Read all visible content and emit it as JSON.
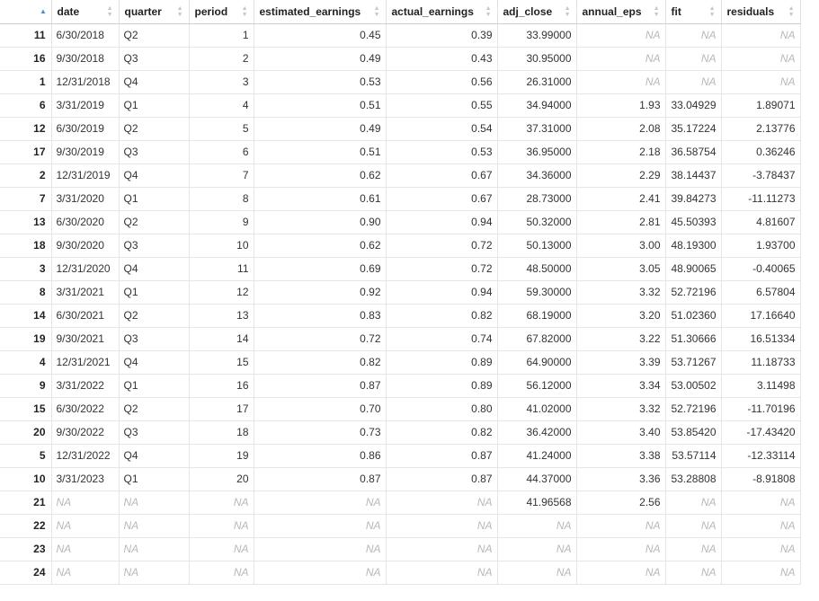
{
  "columns": [
    {
      "key": "idx",
      "label": "",
      "align": "r"
    },
    {
      "key": "date",
      "label": "date",
      "align": "l"
    },
    {
      "key": "quarter",
      "label": "quarter",
      "align": "l"
    },
    {
      "key": "period",
      "label": "period",
      "align": "r"
    },
    {
      "key": "estimated_earnings",
      "label": "estimated_earnings",
      "align": "r"
    },
    {
      "key": "actual_earnings",
      "label": "actual_earnings",
      "align": "r"
    },
    {
      "key": "adj_close",
      "label": "adj_close",
      "align": "r"
    },
    {
      "key": "annual_eps",
      "label": "annual_eps",
      "align": "r"
    },
    {
      "key": "fit",
      "label": "fit",
      "align": "r"
    },
    {
      "key": "residuals",
      "label": "residuals",
      "align": "r"
    }
  ],
  "sort": {
    "column": "idx",
    "direction": "ascending",
    "icon": "sort-ascending-icon"
  },
  "na_text": "NA",
  "rows": [
    [
      "11",
      "6/30/2018",
      "Q2",
      "1",
      "0.45",
      "0.39",
      "33.99000",
      "NA",
      "NA",
      "NA"
    ],
    [
      "16",
      "9/30/2018",
      "Q3",
      "2",
      "0.49",
      "0.43",
      "30.95000",
      "NA",
      "NA",
      "NA"
    ],
    [
      "1",
      "12/31/2018",
      "Q4",
      "3",
      "0.53",
      "0.56",
      "26.31000",
      "NA",
      "NA",
      "NA"
    ],
    [
      "6",
      "3/31/2019",
      "Q1",
      "4",
      "0.51",
      "0.55",
      "34.94000",
      "1.93",
      "33.04929",
      "1.89071"
    ],
    [
      "12",
      "6/30/2019",
      "Q2",
      "5",
      "0.49",
      "0.54",
      "37.31000",
      "2.08",
      "35.17224",
      "2.13776"
    ],
    [
      "17",
      "9/30/2019",
      "Q3",
      "6",
      "0.51",
      "0.53",
      "36.95000",
      "2.18",
      "36.58754",
      "0.36246"
    ],
    [
      "2",
      "12/31/2019",
      "Q4",
      "7",
      "0.62",
      "0.67",
      "34.36000",
      "2.29",
      "38.14437",
      "-3.78437"
    ],
    [
      "7",
      "3/31/2020",
      "Q1",
      "8",
      "0.61",
      "0.67",
      "28.73000",
      "2.41",
      "39.84273",
      "-11.11273"
    ],
    [
      "13",
      "6/30/2020",
      "Q2",
      "9",
      "0.90",
      "0.94",
      "50.32000",
      "2.81",
      "45.50393",
      "4.81607"
    ],
    [
      "18",
      "9/30/2020",
      "Q3",
      "10",
      "0.62",
      "0.72",
      "50.13000",
      "3.00",
      "48.19300",
      "1.93700"
    ],
    [
      "3",
      "12/31/2020",
      "Q4",
      "11",
      "0.69",
      "0.72",
      "48.50000",
      "3.05",
      "48.90065",
      "-0.40065"
    ],
    [
      "8",
      "3/31/2021",
      "Q1",
      "12",
      "0.92",
      "0.94",
      "59.30000",
      "3.32",
      "52.72196",
      "6.57804"
    ],
    [
      "14",
      "6/30/2021",
      "Q2",
      "13",
      "0.83",
      "0.82",
      "68.19000",
      "3.20",
      "51.02360",
      "17.16640"
    ],
    [
      "19",
      "9/30/2021",
      "Q3",
      "14",
      "0.72",
      "0.74",
      "67.82000",
      "3.22",
      "51.30666",
      "16.51334"
    ],
    [
      "4",
      "12/31/2021",
      "Q4",
      "15",
      "0.82",
      "0.89",
      "64.90000",
      "3.39",
      "53.71267",
      "11.18733"
    ],
    [
      "9",
      "3/31/2022",
      "Q1",
      "16",
      "0.87",
      "0.89",
      "56.12000",
      "3.34",
      "53.00502",
      "3.11498"
    ],
    [
      "15",
      "6/30/2022",
      "Q2",
      "17",
      "0.70",
      "0.80",
      "41.02000",
      "3.32",
      "52.72196",
      "-11.70196"
    ],
    [
      "20",
      "9/30/2022",
      "Q3",
      "18",
      "0.73",
      "0.82",
      "36.42000",
      "3.40",
      "53.85420",
      "-17.43420"
    ],
    [
      "5",
      "12/31/2022",
      "Q4",
      "19",
      "0.86",
      "0.87",
      "41.24000",
      "3.38",
      "53.57114",
      "-12.33114"
    ],
    [
      "10",
      "3/31/2023",
      "Q1",
      "20",
      "0.87",
      "0.87",
      "44.37000",
      "3.36",
      "53.28808",
      "-8.91808"
    ],
    [
      "21",
      "NA",
      "NA",
      "NA",
      "NA",
      "NA",
      "41.96568",
      "2.56",
      "NA",
      "NA"
    ],
    [
      "22",
      "NA",
      "NA",
      "NA",
      "NA",
      "NA",
      "NA",
      "NA",
      "NA",
      "NA"
    ],
    [
      "23",
      "NA",
      "NA",
      "NA",
      "NA",
      "NA",
      "NA",
      "NA",
      "NA",
      "NA"
    ],
    [
      "24",
      "NA",
      "NA",
      "NA",
      "NA",
      "NA",
      "NA",
      "NA",
      "NA",
      "NA"
    ]
  ]
}
